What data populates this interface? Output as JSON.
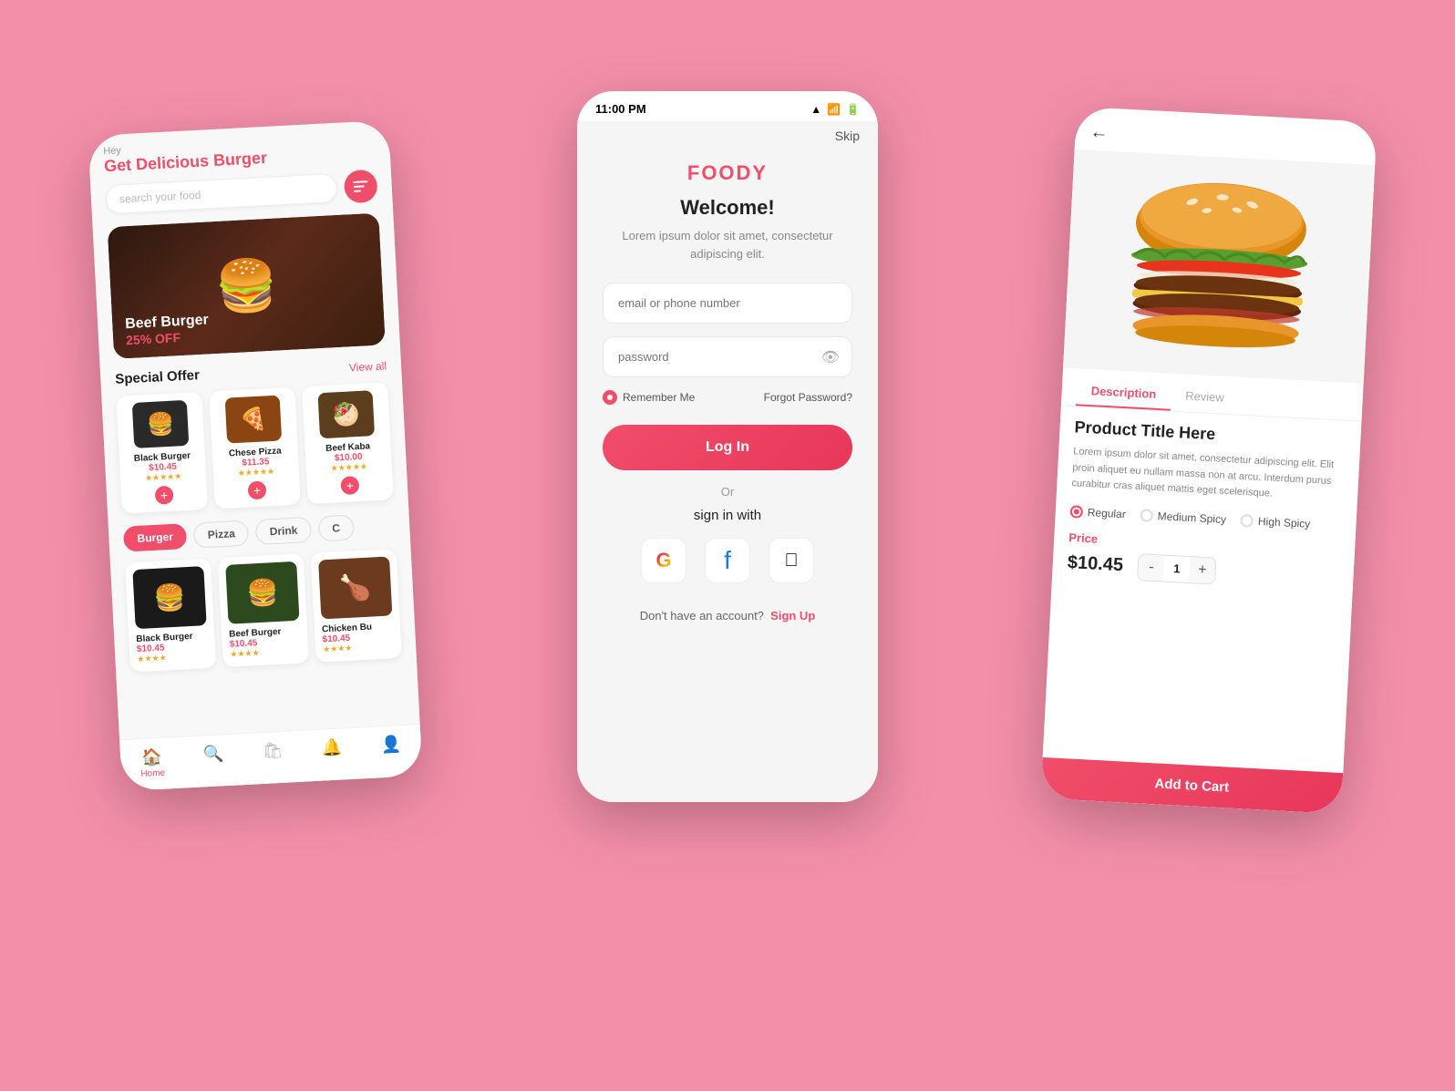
{
  "background": "#f48faa",
  "phone_home": {
    "header": {
      "subtitle": "Hey",
      "title": "Get Delicious Burger"
    },
    "search": {
      "placeholder": "search your food"
    },
    "banner": {
      "item_name": "Beef Burger",
      "discount": "25% OFF"
    },
    "special_offer": {
      "title": "Special Offer",
      "view_all": "View all",
      "items": [
        {
          "name": "Black Burger",
          "price": "$10.45",
          "emoji": "🍔"
        },
        {
          "name": "Chese Pizza",
          "price": "$11.35",
          "emoji": "🍕"
        },
        {
          "name": "Beef Kaba",
          "price": "$10.00",
          "emoji": "🥙"
        }
      ]
    },
    "categories": [
      "Burger",
      "Pizza",
      "Drink",
      "C"
    ],
    "active_category": "Burger",
    "food_items": [
      {
        "name": "Black Burger",
        "price": "$10.45",
        "emoji": "🍔"
      },
      {
        "name": "Beef Burger",
        "price": "$10.45",
        "emoji": "🍔"
      },
      {
        "name": "Chicken Bu",
        "price": "$10.45",
        "emoji": "🍗"
      }
    ],
    "navbar": [
      {
        "label": "Home",
        "icon": "🏠",
        "active": true
      },
      {
        "label": "",
        "icon": "🔍",
        "active": false
      },
      {
        "label": "",
        "icon": "🛍",
        "active": false
      },
      {
        "label": "",
        "icon": "🔔",
        "active": false
      },
      {
        "label": "",
        "icon": "👤",
        "active": false
      }
    ]
  },
  "phone_login": {
    "status_bar": {
      "time": "11:00 PM",
      "wifi": "wifi",
      "signal": "signal",
      "battery": "battery"
    },
    "skip_label": "Skip",
    "brand": "FOODY",
    "welcome_title": "Welcome!",
    "subtitle": "Lorem ipsum dolor sit amet, consectetur adipiscing elit.",
    "email_placeholder": "email or phone number",
    "password_placeholder": "password",
    "remember_me": "Remember Me",
    "forgot_password": "Forgot Password?",
    "login_button": "Log In",
    "or_text": "Or",
    "sign_in_with": "sign in with",
    "social": [
      "G",
      "f",
      ""
    ],
    "no_account_text": "Don't have an account?",
    "signup_text": "Sign Up"
  },
  "phone_detail": {
    "back_icon": "←",
    "tabs": [
      "Description",
      "Review"
    ],
    "active_tab": "Description",
    "product_title": "Product Title Here",
    "product_desc": "Lorem ipsum dolor sit amet, consectetur adipiscing elit. Elit proin aliquet eu nullam massa non at arcu. Interdum purus curabitur cras aliquet mattis eget scelerisque.",
    "spice_options": [
      {
        "label": "Regular",
        "selected": true
      },
      {
        "label": "Medium Spicy",
        "selected": false
      },
      {
        "label": "High Spicy",
        "selected": false
      }
    ],
    "price_label": "Price",
    "price": "$10.45",
    "quantity": 1,
    "qty_minus": "-",
    "qty_plus": "+",
    "add_cart_label": "Add to Cart"
  }
}
